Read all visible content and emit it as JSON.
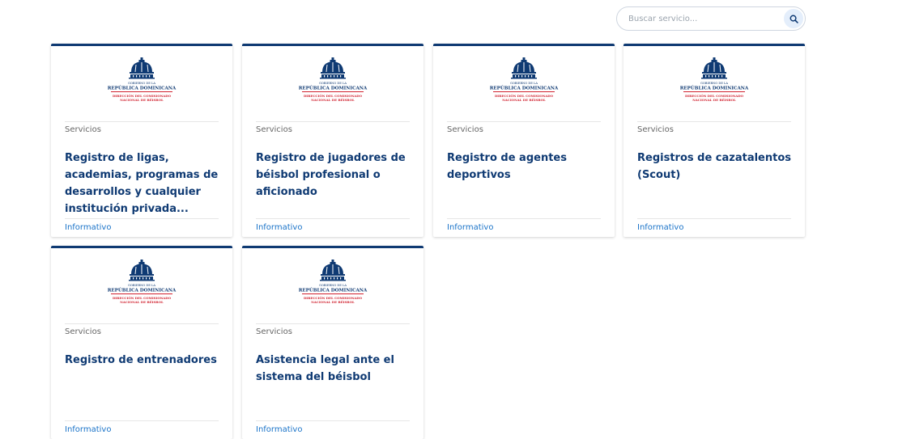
{
  "search": {
    "placeholder": "Buscar servicio..."
  },
  "logo": {
    "line1": "GOBIERNO DE LA",
    "line2": "REPÚBLICA DOMINICANA",
    "line3": "DIRECCIÓN DEL COMISIONADO",
    "line4": "NACIONAL DE BÉISBOL"
  },
  "colors": {
    "primary": "#0f3a73",
    "accent_red": "#d0202e",
    "link": "#1a73c8"
  },
  "cards": [
    {
      "category": "Servicios",
      "title": "Registro de ligas, academias, programas de desarrollos y cualquier institución privada...",
      "tag": "Informativo"
    },
    {
      "category": "Servicios",
      "title": "Registro de jugadores de béisbol profesional o aficionado",
      "tag": "Informativo"
    },
    {
      "category": "Servicios",
      "title": "Registro de agentes deportivos",
      "tag": "Informativo"
    },
    {
      "category": "Servicios",
      "title": "Registros de cazatalentos (Scout)",
      "tag": "Informativo"
    },
    {
      "category": "Servicios",
      "title": "Registro de entrenadores",
      "tag": "Informativo"
    },
    {
      "category": "Servicios",
      "title": "Asistencia legal ante el sistema del béisbol",
      "tag": "Informativo"
    }
  ]
}
